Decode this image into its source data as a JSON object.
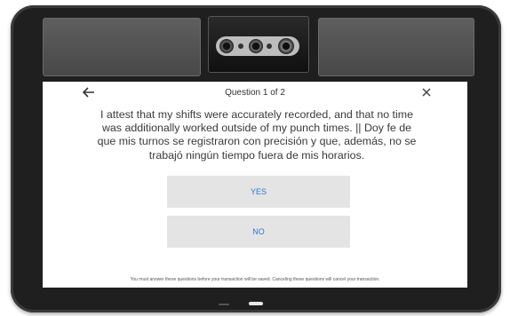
{
  "header": {
    "back_icon": "arrow-left-icon",
    "title": "Question 1 of 2",
    "close_icon": "close-icon"
  },
  "question": {
    "text": "I attest that my shifts were accurately recorded, and that no time was additionally worked outside of my punch times. || Doy fe de que mis turnos se registraron con precisión y que, además, no se trabajó ningún tiempo fuera de mis horarios."
  },
  "answers": {
    "yes_label": "YES",
    "no_label": "NO"
  },
  "footer": {
    "note": "You must answer these questions before your transaction will be saved. Canceling these questions will cancel your transaction."
  },
  "colors": {
    "accent": "#2a79d2",
    "button_bg": "#e4e4e4",
    "device": "#1f1f1f"
  }
}
